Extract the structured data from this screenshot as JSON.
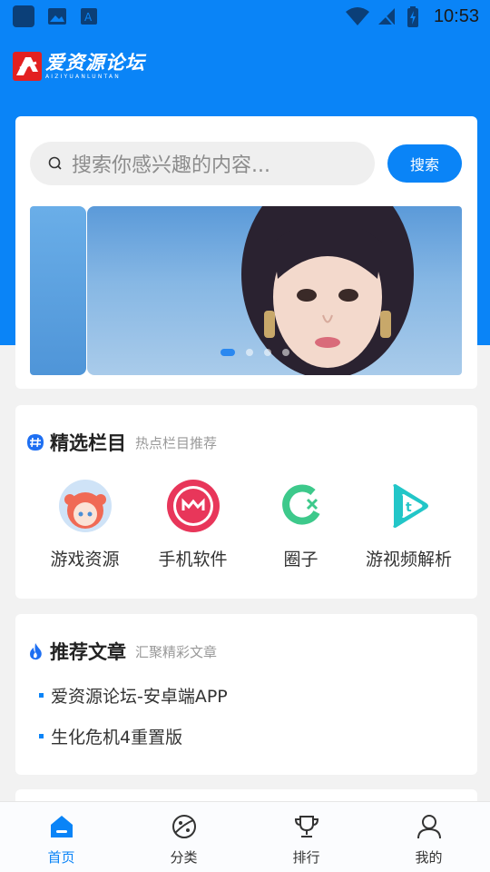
{
  "status_bar": {
    "time": "10:53"
  },
  "logo": {
    "title": "爱资源论坛",
    "subtitle": "AIZIYUANLUNTAN"
  },
  "search": {
    "placeholder": "搜索你感兴趣的内容...",
    "button_label": "搜索"
  },
  "banner": {
    "slide_count": 4,
    "active_slide": 1
  },
  "featured": {
    "title": "精选栏目",
    "subtitle": "热点栏目推荐",
    "items": [
      {
        "label": "游戏资源",
        "icon": "anime-avatar-icon"
      },
      {
        "label": "手机软件",
        "icon": "app-logo-icon"
      },
      {
        "label": "圈子",
        "icon": "circle-logo-icon"
      },
      {
        "label": "游视频解析",
        "icon": "video-play-icon"
      }
    ]
  },
  "articles": {
    "title": "推荐文章",
    "subtitle": "汇聚精彩文章",
    "items": [
      {
        "label": "爱资源论坛-安卓端APP"
      },
      {
        "label": "生化危机4重置版"
      }
    ]
  },
  "nav": {
    "items": [
      {
        "label": "首页",
        "icon": "home-icon",
        "active": true
      },
      {
        "label": "分类",
        "icon": "planet-icon",
        "active": false
      },
      {
        "label": "排行",
        "icon": "trophy-icon",
        "active": false
      },
      {
        "label": "我的",
        "icon": "user-icon",
        "active": false
      }
    ]
  },
  "colors": {
    "primary": "#0a84f7",
    "background": "#f2f2f2",
    "logo_red": "#e32020"
  }
}
